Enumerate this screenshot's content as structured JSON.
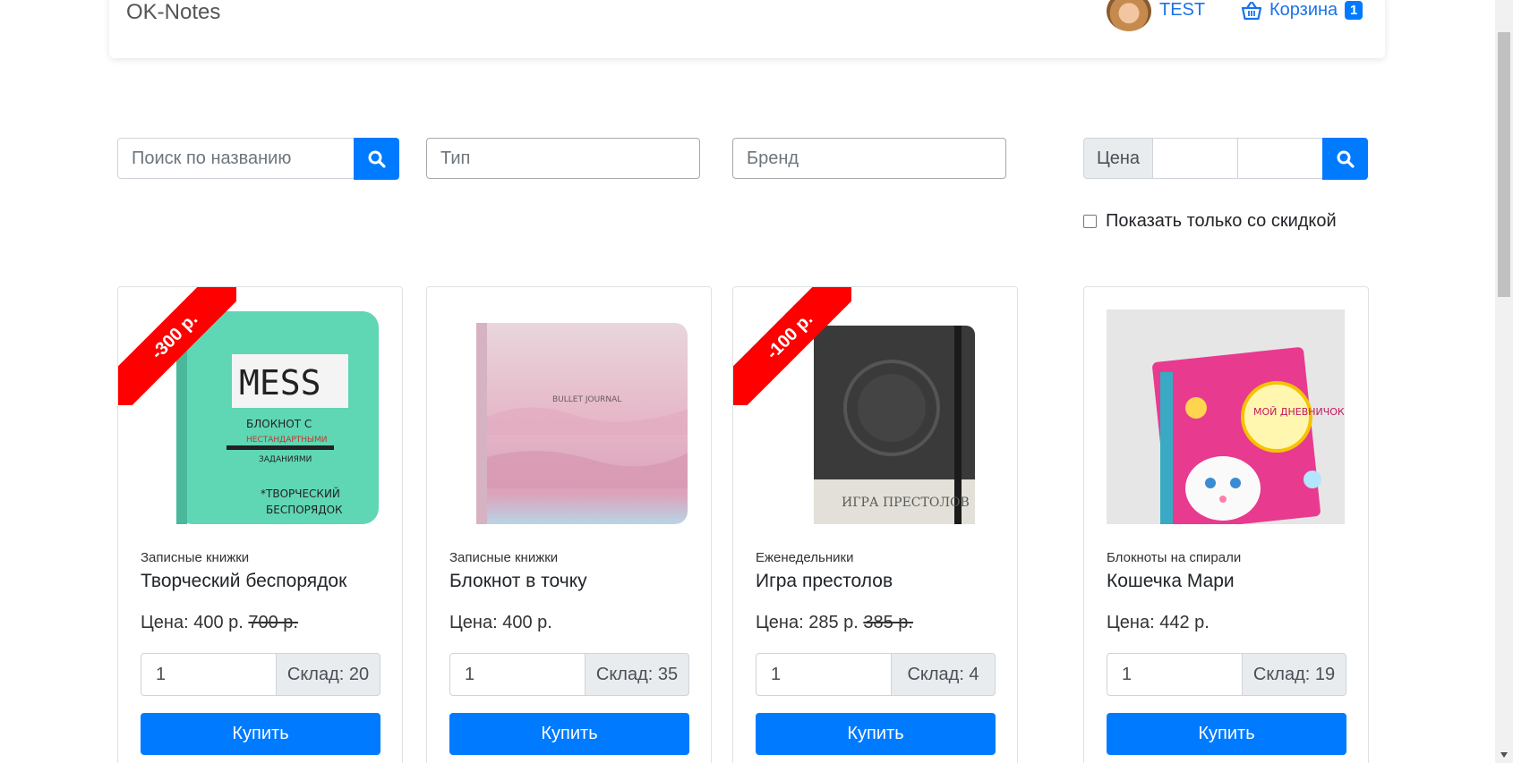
{
  "header": {
    "brand": "OK-Notes",
    "user_name": "TEST",
    "cart_label": "Корзина",
    "cart_count": "1"
  },
  "filters": {
    "search_placeholder": "Поиск по названию",
    "type_placeholder": "Тип",
    "brand_placeholder": "Бренд",
    "price_label": "Цена",
    "discount_label": "Показать только со скидкой"
  },
  "colors": {
    "primary": "#007bff",
    "ribbon": "#ff0000"
  },
  "products": [
    {
      "category": "Записные книжки",
      "title": "Творческий беспорядок",
      "price_label": "Цена: 400 р.",
      "old_price": "700 р.",
      "discount": "-300 р.",
      "quantity": "1",
      "stock": "Склад: 20",
      "buy_label": "Купить"
    },
    {
      "category": "Записные книжки",
      "title": "Блокнот в точку",
      "price_label": "Цена: 400 р.",
      "old_price": "",
      "discount": "",
      "quantity": "1",
      "stock": "Склад: 35",
      "buy_label": "Купить"
    },
    {
      "category": "Еженедельники",
      "title": "Игра престолов",
      "price_label": "Цена: 285 р.",
      "old_price": "385 р.",
      "discount": "-100 р.",
      "quantity": "1",
      "stock": "Склад: 4",
      "buy_label": "Купить"
    },
    {
      "category": "Блокноты на спирали",
      "title": "Кошечка Мари",
      "price_label": "Цена: 442 р.",
      "old_price": "",
      "discount": "",
      "quantity": "1",
      "stock": "Склад: 19",
      "buy_label": "Купить"
    }
  ],
  "product_images": {
    "p1_cover_title": "MESS",
    "p1_cover_sub1": "БЛОКНОТ С",
    "p1_cover_sub2": "НЕСТАНДАРТНЫМИ",
    "p1_cover_sub3": "ЗАДАНИЯМИ",
    "p1_cover_sub4": "*ТВОРЧЕСКИЙ",
    "p1_cover_sub5": "БЕСПОРЯДОК",
    "p2_cover_title": "BULLET JOURNAL",
    "p3_cover_title": "ИГРА ПРЕСТОЛОВ",
    "p4_cover_title": "МОЙ ДНЕВНИЧОК"
  }
}
